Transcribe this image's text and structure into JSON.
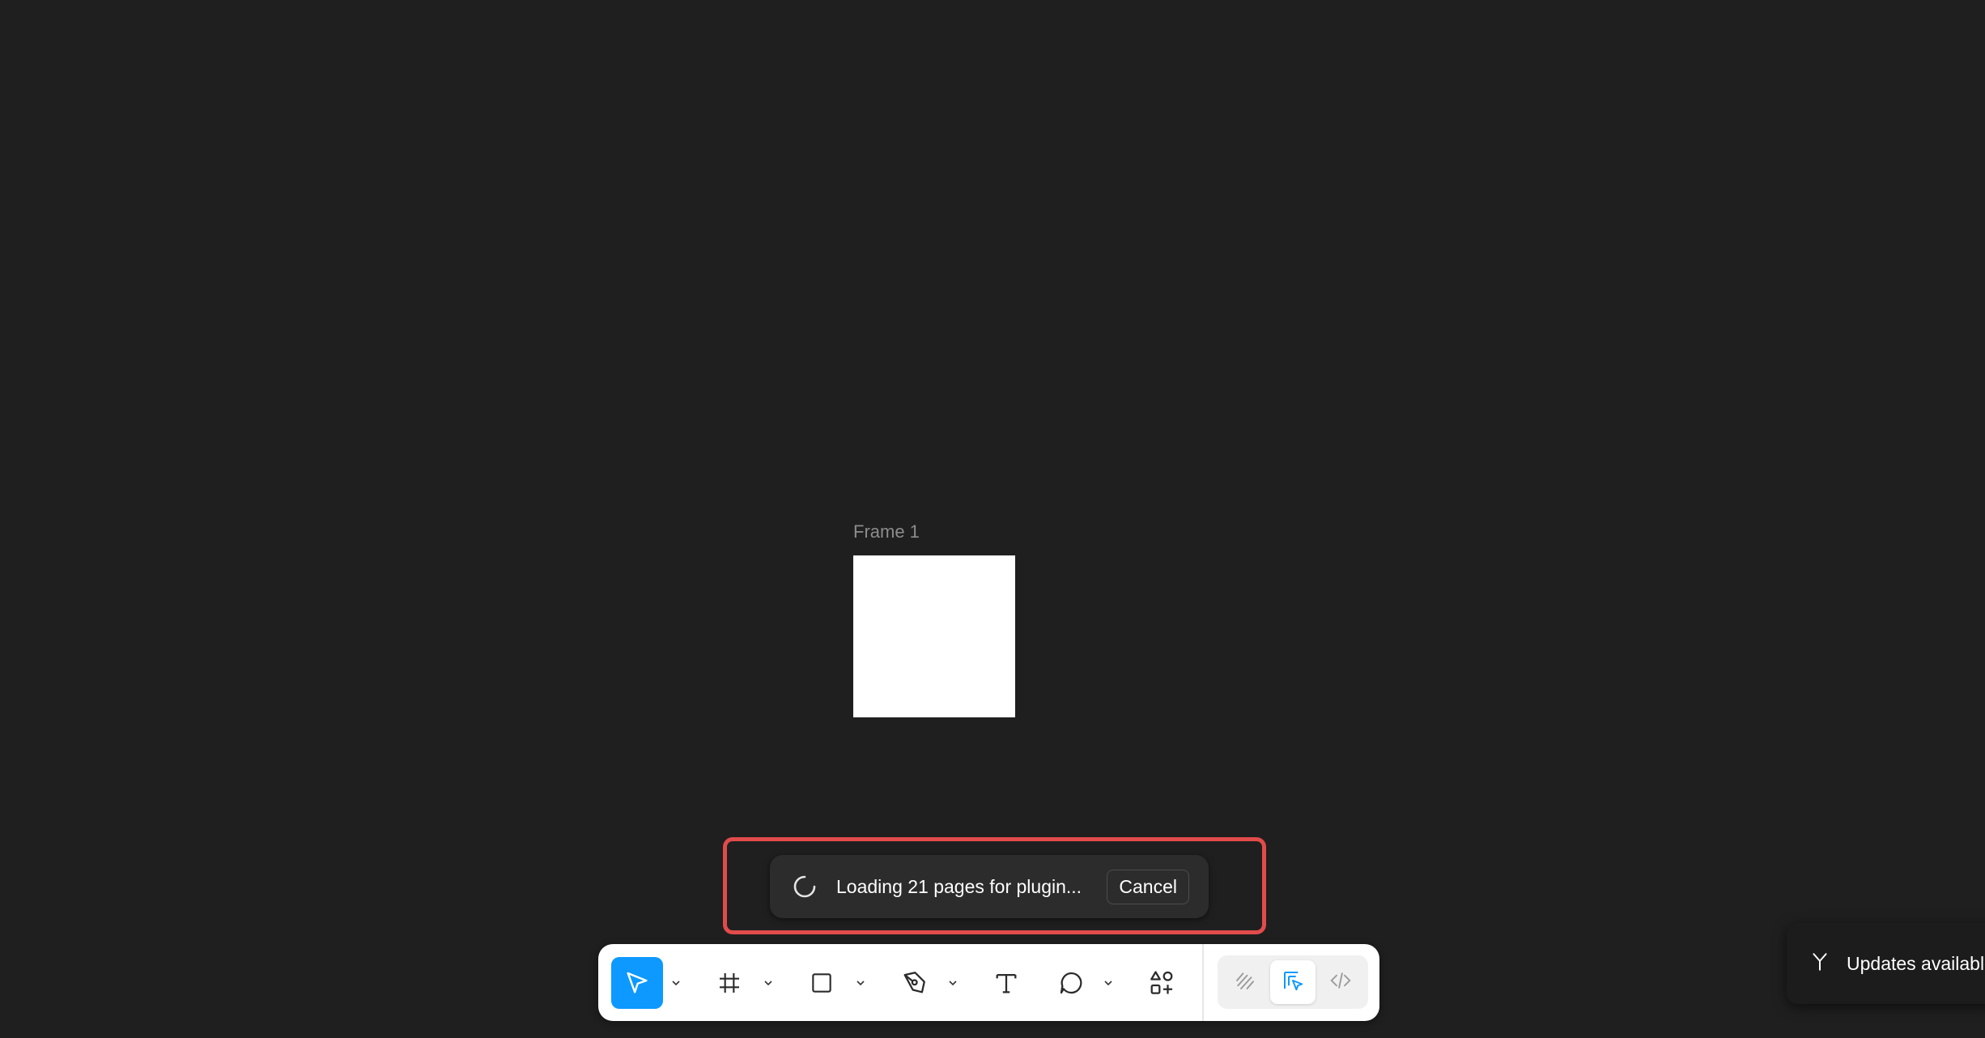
{
  "canvas": {
    "frame_label": "Frame 1"
  },
  "toast": {
    "message": "Loading 21 pages for plugin...",
    "cancel_label": "Cancel",
    "icon": "spinner-icon"
  },
  "toolbar": {
    "tools": [
      {
        "name": "move-tool",
        "icon": "cursor-arrow-icon",
        "active": true
      },
      {
        "name": "frame-tool",
        "icon": "hash-frame-icon"
      },
      {
        "name": "shape-tool",
        "icon": "rectangle-icon"
      },
      {
        "name": "pen-tool",
        "icon": "pen-nib-icon"
      },
      {
        "name": "text-tool",
        "icon": "text-t-icon"
      },
      {
        "name": "comment-tool",
        "icon": "speech-bubble-icon"
      },
      {
        "name": "actions-tool",
        "icon": "shapes-plus-icon"
      }
    ],
    "modes": [
      {
        "name": "draw-mode",
        "icon": "draw-squiggle-icon"
      },
      {
        "name": "design-mode",
        "icon": "design-cursor-icon",
        "active": true
      },
      {
        "name": "dev-mode",
        "icon": "code-brackets-icon"
      }
    ]
  },
  "update_notice": {
    "text": "Updates available",
    "icon": "merge-branch-icon"
  },
  "colors": {
    "canvas_bg": "#1f1f1f",
    "accent": "#0d99ff",
    "highlight_border": "#e24b4b",
    "toast_bg": "#2c2c2c"
  }
}
